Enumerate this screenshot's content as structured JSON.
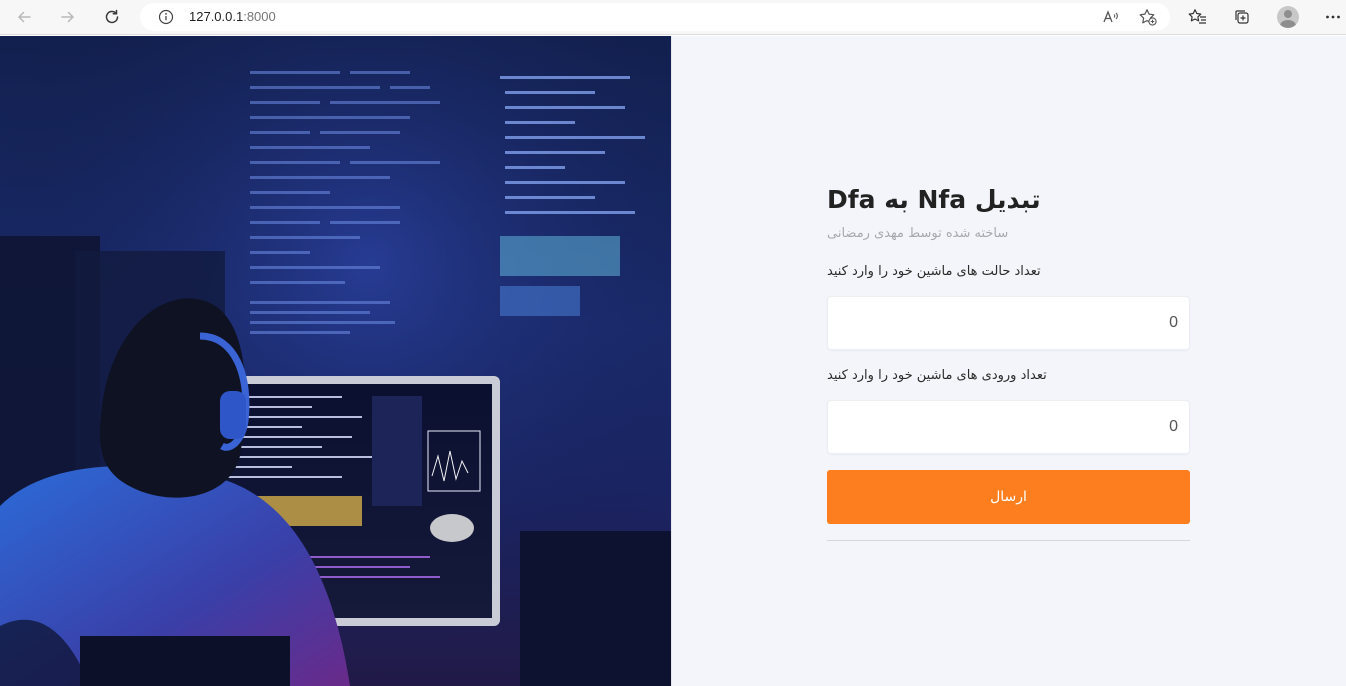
{
  "browser": {
    "url_host": "127.0.0.1",
    "url_port": ":8000",
    "icons": {
      "back": "back-arrow-icon",
      "forward": "forward-arrow-icon",
      "reload": "reload-icon",
      "site_info": "info-icon",
      "read_aloud": "read-aloud-icon",
      "add_favorite": "star-add-icon",
      "favorites": "favorites-icon",
      "collections": "collections-icon",
      "profile": "profile-avatar",
      "menu": "more-menu-icon"
    }
  },
  "hero": {
    "image": "person-at-computer-illustration"
  },
  "form": {
    "title": "تبدیل Nfa به Dfa",
    "subtitle": "ساخته شده توسط مهدی رمضانی",
    "states_label": "تعداد حالت های ماشین خود را وارد کنید",
    "states_value": "0",
    "inputs_label": "تعداد ورودی های ماشین خود را وارد کنید",
    "inputs_value": "0",
    "submit_label": "ارسال"
  },
  "colors": {
    "accent": "#fd7e1e",
    "panel_bg": "#f4f5fa",
    "hero_bg": "#1a2a6b"
  }
}
